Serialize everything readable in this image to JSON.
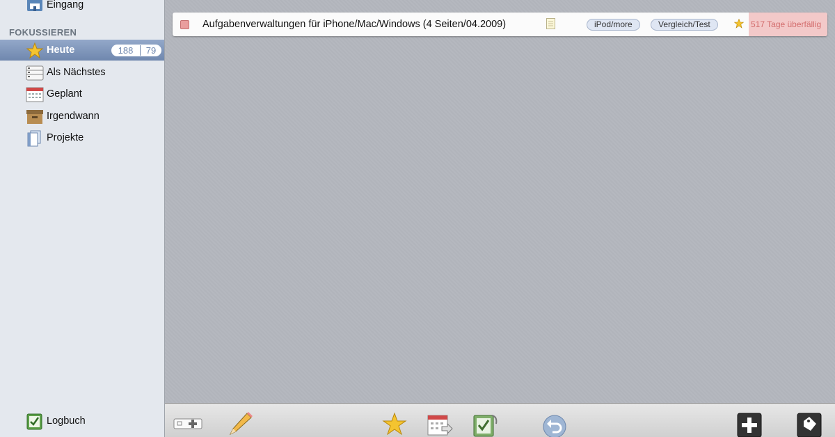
{
  "sidebar": {
    "inbox_label": "Eingang",
    "section_focus": "FOKUSSIEREN",
    "items": [
      {
        "label": "Heute",
        "count_main": "188",
        "count_secondary": "79"
      },
      {
        "label": "Als Nächstes"
      },
      {
        "label": "Geplant"
      },
      {
        "label": "Irgendwann"
      },
      {
        "label": "Projekte"
      }
    ],
    "logbook_label": "Logbuch"
  },
  "task": {
    "title": "Aufgabenverwaltungen für iPhone/Mac/Windows (4 Seiten/04.2009)",
    "tags": [
      "iPod/more",
      "Vergleich/Test"
    ],
    "overdue": "517 Tage überfällig"
  },
  "toolbar": {
    "icons": [
      "add-item-icon",
      "pencil-icon",
      "star-icon",
      "calendar-move-icon",
      "checkbook-icon",
      "undo-icon",
      "plus-icon",
      "tag-icon"
    ]
  },
  "colors": {
    "selection": "#7b92b8",
    "overdue_bg": "#f3c9c9",
    "overdue_text": "#d36d6d",
    "checkbox": "#e99e9e"
  }
}
